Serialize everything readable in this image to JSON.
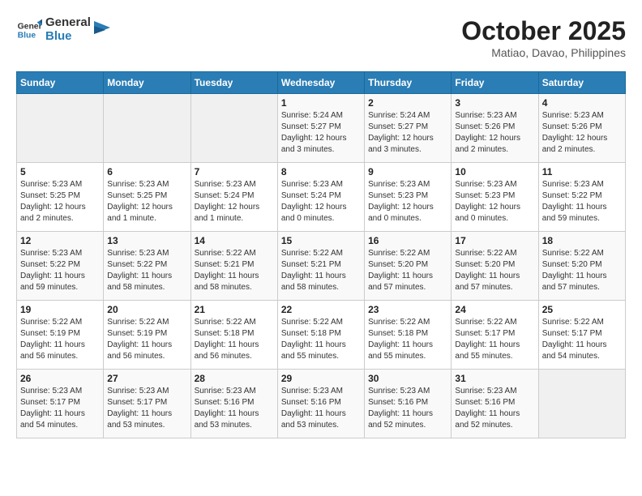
{
  "header": {
    "logo_line1": "General",
    "logo_line2": "Blue",
    "month": "October 2025",
    "location": "Matiao, Davao, Philippines"
  },
  "weekdays": [
    "Sunday",
    "Monday",
    "Tuesday",
    "Wednesday",
    "Thursday",
    "Friday",
    "Saturday"
  ],
  "weeks": [
    [
      {
        "day": "",
        "info": ""
      },
      {
        "day": "",
        "info": ""
      },
      {
        "day": "",
        "info": ""
      },
      {
        "day": "1",
        "info": "Sunrise: 5:24 AM\nSunset: 5:27 PM\nDaylight: 12 hours\nand 3 minutes."
      },
      {
        "day": "2",
        "info": "Sunrise: 5:24 AM\nSunset: 5:27 PM\nDaylight: 12 hours\nand 3 minutes."
      },
      {
        "day": "3",
        "info": "Sunrise: 5:23 AM\nSunset: 5:26 PM\nDaylight: 12 hours\nand 2 minutes."
      },
      {
        "day": "4",
        "info": "Sunrise: 5:23 AM\nSunset: 5:26 PM\nDaylight: 12 hours\nand 2 minutes."
      }
    ],
    [
      {
        "day": "5",
        "info": "Sunrise: 5:23 AM\nSunset: 5:25 PM\nDaylight: 12 hours\nand 2 minutes."
      },
      {
        "day": "6",
        "info": "Sunrise: 5:23 AM\nSunset: 5:25 PM\nDaylight: 12 hours\nand 1 minute."
      },
      {
        "day": "7",
        "info": "Sunrise: 5:23 AM\nSunset: 5:24 PM\nDaylight: 12 hours\nand 1 minute."
      },
      {
        "day": "8",
        "info": "Sunrise: 5:23 AM\nSunset: 5:24 PM\nDaylight: 12 hours\nand 0 minutes."
      },
      {
        "day": "9",
        "info": "Sunrise: 5:23 AM\nSunset: 5:23 PM\nDaylight: 12 hours\nand 0 minutes."
      },
      {
        "day": "10",
        "info": "Sunrise: 5:23 AM\nSunset: 5:23 PM\nDaylight: 12 hours\nand 0 minutes."
      },
      {
        "day": "11",
        "info": "Sunrise: 5:23 AM\nSunset: 5:22 PM\nDaylight: 11 hours\nand 59 minutes."
      }
    ],
    [
      {
        "day": "12",
        "info": "Sunrise: 5:23 AM\nSunset: 5:22 PM\nDaylight: 11 hours\nand 59 minutes."
      },
      {
        "day": "13",
        "info": "Sunrise: 5:23 AM\nSunset: 5:22 PM\nDaylight: 11 hours\nand 58 minutes."
      },
      {
        "day": "14",
        "info": "Sunrise: 5:22 AM\nSunset: 5:21 PM\nDaylight: 11 hours\nand 58 minutes."
      },
      {
        "day": "15",
        "info": "Sunrise: 5:22 AM\nSunset: 5:21 PM\nDaylight: 11 hours\nand 58 minutes."
      },
      {
        "day": "16",
        "info": "Sunrise: 5:22 AM\nSunset: 5:20 PM\nDaylight: 11 hours\nand 57 minutes."
      },
      {
        "day": "17",
        "info": "Sunrise: 5:22 AM\nSunset: 5:20 PM\nDaylight: 11 hours\nand 57 minutes."
      },
      {
        "day": "18",
        "info": "Sunrise: 5:22 AM\nSunset: 5:20 PM\nDaylight: 11 hours\nand 57 minutes."
      }
    ],
    [
      {
        "day": "19",
        "info": "Sunrise: 5:22 AM\nSunset: 5:19 PM\nDaylight: 11 hours\nand 56 minutes."
      },
      {
        "day": "20",
        "info": "Sunrise: 5:22 AM\nSunset: 5:19 PM\nDaylight: 11 hours\nand 56 minutes."
      },
      {
        "day": "21",
        "info": "Sunrise: 5:22 AM\nSunset: 5:18 PM\nDaylight: 11 hours\nand 56 minutes."
      },
      {
        "day": "22",
        "info": "Sunrise: 5:22 AM\nSunset: 5:18 PM\nDaylight: 11 hours\nand 55 minutes."
      },
      {
        "day": "23",
        "info": "Sunrise: 5:22 AM\nSunset: 5:18 PM\nDaylight: 11 hours\nand 55 minutes."
      },
      {
        "day": "24",
        "info": "Sunrise: 5:22 AM\nSunset: 5:17 PM\nDaylight: 11 hours\nand 55 minutes."
      },
      {
        "day": "25",
        "info": "Sunrise: 5:22 AM\nSunset: 5:17 PM\nDaylight: 11 hours\nand 54 minutes."
      }
    ],
    [
      {
        "day": "26",
        "info": "Sunrise: 5:23 AM\nSunset: 5:17 PM\nDaylight: 11 hours\nand 54 minutes."
      },
      {
        "day": "27",
        "info": "Sunrise: 5:23 AM\nSunset: 5:17 PM\nDaylight: 11 hours\nand 53 minutes."
      },
      {
        "day": "28",
        "info": "Sunrise: 5:23 AM\nSunset: 5:16 PM\nDaylight: 11 hours\nand 53 minutes."
      },
      {
        "day": "29",
        "info": "Sunrise: 5:23 AM\nSunset: 5:16 PM\nDaylight: 11 hours\nand 53 minutes."
      },
      {
        "day": "30",
        "info": "Sunrise: 5:23 AM\nSunset: 5:16 PM\nDaylight: 11 hours\nand 52 minutes."
      },
      {
        "day": "31",
        "info": "Sunrise: 5:23 AM\nSunset: 5:16 PM\nDaylight: 11 hours\nand 52 minutes."
      },
      {
        "day": "",
        "info": ""
      }
    ]
  ]
}
